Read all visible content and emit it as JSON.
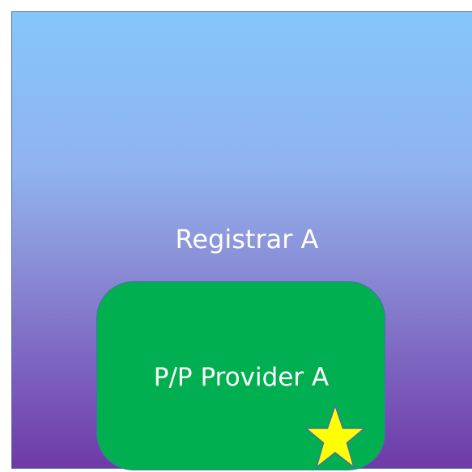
{
  "registrar": {
    "label": "Registrar A",
    "fill_gradient": [
      "#85c6fb",
      "#6e3aa7"
    ],
    "border_color": "#4a6fa8"
  },
  "provider": {
    "label": "P/P Provider A",
    "fill_color": "#00b050"
  },
  "marker": {
    "icon": "star-icon",
    "color": "#ffff00"
  }
}
